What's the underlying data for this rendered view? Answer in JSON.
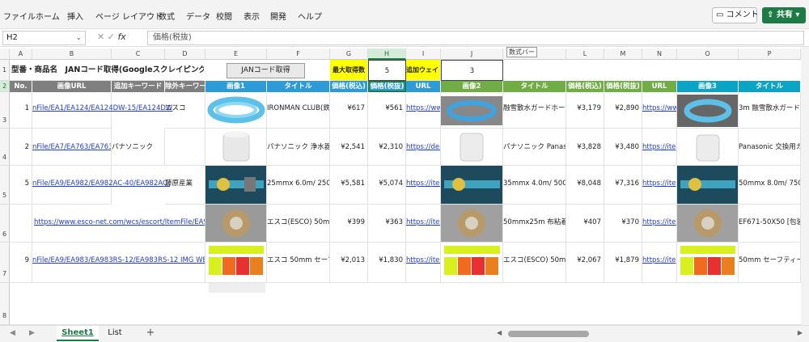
{
  "menu": [
    "ファイル",
    "ホーム",
    "挿入",
    "ページ レイアウト",
    "数式",
    "データ",
    "校閲",
    "表示",
    "開発",
    "ヘルプ"
  ],
  "actions": {
    "comment": "コメント",
    "share": "共有"
  },
  "formula_bar": {
    "cell_ref": "H2",
    "formula": "価格(税抜)",
    "fx": "fx"
  },
  "columns": [
    "A",
    "B",
    "C",
    "D",
    "E",
    "F",
    "G",
    "H",
    "I",
    "J",
    "K",
    "L",
    "M",
    "N",
    "O",
    "P"
  ],
  "rows": [
    "1",
    "2",
    "3",
    "4",
    "5",
    "6",
    "7",
    "8"
  ],
  "tooltip": "数式バー",
  "row1": {
    "title": "型番・商品名　JANコード取得(Googleスクレイピング版)",
    "button": "JANコード取得",
    "max_label": "最大取得数",
    "max_value": "5",
    "wait_label": "追加ウェイト",
    "wait_value": "3"
  },
  "headers": [
    "No.",
    "画像URL",
    "追加キーワード",
    "除外キーワード",
    "画像1",
    "タイトル",
    "価格(税込)",
    "価格(税抜)",
    "URL",
    "画像2",
    "タイトル",
    "価格(税込)",
    "価格(税抜)",
    "URL",
    "画像3",
    "タイトル"
  ],
  "header_colors": {
    "gray": "#7f7f7f",
    "blue": "#2e9bd6",
    "green": "#70ad47",
    "teal": "#0ca4c4"
  },
  "data_rows": [
    {
      "no": "1",
      "url": "nFile/EA1/EA124/EA124DW-15/EA124DW",
      "kw": "",
      "ex": "エスコ",
      "title1": "IRONMAN CLUB(鉄",
      "p1": "¥617",
      "q1": "¥561",
      "u1": "https://www",
      "title2": "融雪散水ガードホー",
      "p2": "¥3,179",
      "q2": "¥2,890",
      "u2": "https://www",
      "title3": "3m 融雪散水ガード"
    },
    {
      "no": "2",
      "url": "nFile/EA7/EA763/EA763",
      "kw": "パナソニック",
      "ex": "",
      "title1": "パナソニック 浄水器",
      "p1": "¥2,541",
      "q1": "¥2,310",
      "u1": "https://dem",
      "title2": "パナソニック Panaso",
      "p2": "¥3,828",
      "q2": "¥3,480",
      "u2": "https://ite",
      "title3": "Panasonic 交換用カ"
    },
    {
      "no": "5",
      "url": "nFile/EA9/EA982/EA982AC-40/EA982AC-",
      "kw": "",
      "ex": "藤原産業",
      "title1": "25mmx 6.0m/ 250Kg",
      "p1": "¥5,581",
      "q1": "¥5,074",
      "u1": "https://iten",
      "title2": "35mmx 4.0m/ 500Kg",
      "p2": "¥8,048",
      "q2": "¥7,316",
      "u2": "https://ite",
      "title3": "50mmx 8.0m/ 750K"
    },
    {
      "no": "",
      "url": "https://www.esco-net.com/wcs/escort/ItemFile/EA9/E",
      "kw": "",
      "ex": "",
      "title1": "エスコ(ESCO) 50mm",
      "p1": "¥399",
      "q1": "¥363",
      "u1": "https://iten",
      "title2": "50mmx25m 布粘着テ",
      "p2": "¥407",
      "q2": "¥370",
      "u2": "https://iter",
      "title3": "EF671-50X50 [包装"
    },
    {
      "no": "9",
      "url": "nFile/EA9/EA983/EA983RS-12/EA983RS-12 IMG WEB",
      "kw": "",
      "ex": "",
      "title1": "エスコ 50mm セーフ",
      "p1": "¥2,013",
      "q1": "¥1,830",
      "u1": "https://iten",
      "title2": "エスコ(ESCO) 50mr",
      "p2": "¥2,067",
      "q2": "¥1,879",
      "u2": "https://ite",
      "title3": "50mm セーフティー"
    }
  ],
  "sheets": [
    "Sheet1",
    "List"
  ],
  "add_sheet": "+"
}
